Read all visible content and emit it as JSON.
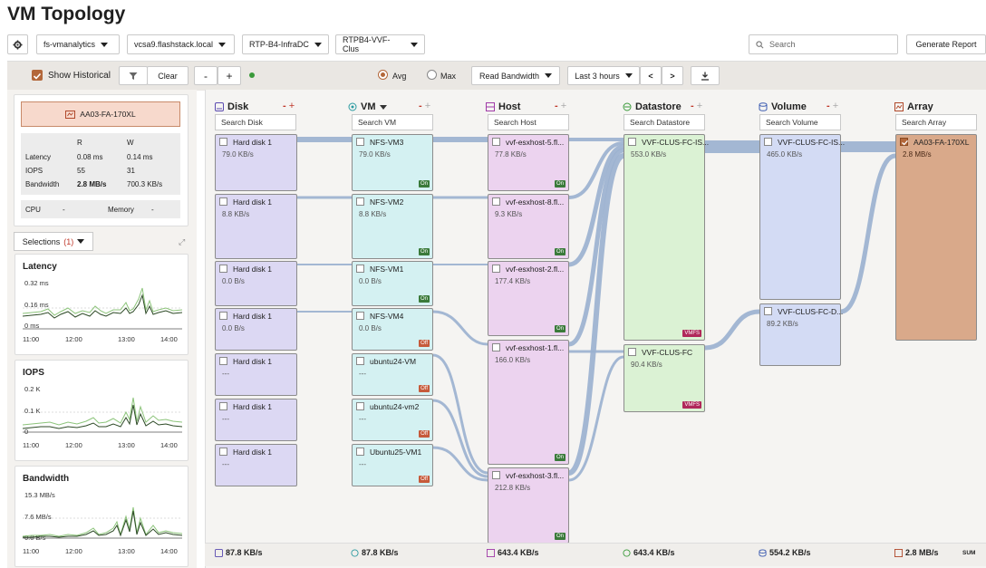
{
  "title": "VM Topology",
  "toolbar": {
    "gear_icon": "gear-icon",
    "vmanalytics": "fs-vmanalytics",
    "vcsa": "vcsa9.flashstack.local",
    "infra": "RTP-B4-InfraDC",
    "cluster": "RTPB4-VVF-Clus",
    "search_placeholder": "Search",
    "generate_report": "Generate Report"
  },
  "controls": {
    "show_historical": "Show Historical",
    "clear": "Clear",
    "minus": "-",
    "plus": "+",
    "avg": "Avg",
    "max": "Max",
    "metric": "Read Bandwidth",
    "range": "Last 3 hours",
    "prev": "<",
    "next": ">"
  },
  "summary": {
    "array_name": "AA03-FA-170XL",
    "col_r": "R",
    "col_w": "W",
    "rows": [
      {
        "label": "Latency",
        "r": "0.08 ms",
        "w": "0.14 ms"
      },
      {
        "label": "IOPS",
        "r": "55",
        "w": "31"
      },
      {
        "label": "Bandwidth",
        "r": "2.8 MB/s",
        "w": "700.3 KB/s"
      }
    ],
    "cpu_label": "CPU",
    "cpu_val": "-",
    "mem_label": "Memory",
    "mem_val": "-"
  },
  "selections": {
    "label": "Selections",
    "count": "(1)"
  },
  "charts": [
    {
      "title": "Latency",
      "ticks": [
        "0.32 ms",
        "0.16 ms",
        "0 ms"
      ],
      "times": [
        "11:00",
        "12:00",
        "13:00",
        "14:00"
      ]
    },
    {
      "title": "IOPS",
      "ticks": [
        "0.2 K",
        "0.1 K",
        "0"
      ],
      "times": [
        "11:00",
        "12:00",
        "13:00",
        "14:00"
      ]
    },
    {
      "title": "Bandwidth",
      "ticks": [
        "15.3 MB/s",
        "7.6 MB/s",
        "0.0 B/s"
      ],
      "times": [
        "11:00",
        "12:00",
        "13:00",
        "14:00"
      ]
    }
  ],
  "columns": [
    {
      "title": "Disk",
      "search": "Search Disk"
    },
    {
      "title": "VM",
      "search": "Search VM"
    },
    {
      "title": "Host",
      "search": "Search Host"
    },
    {
      "title": "Datastore",
      "search": "Search Datastore"
    },
    {
      "title": "Volume",
      "search": "Search Volume"
    },
    {
      "title": "Array",
      "search": "Search Array"
    }
  ],
  "disks": [
    {
      "name": "Hard disk 1",
      "value": "79.0 KB/s"
    },
    {
      "name": "Hard disk 1",
      "value": "8.8 KB/s"
    },
    {
      "name": "Hard disk 1",
      "value": "0.0 B/s"
    },
    {
      "name": "Hard disk 1",
      "value": "0.0 B/s"
    },
    {
      "name": "Hard disk 1",
      "value": "---"
    },
    {
      "name": "Hard disk 1",
      "value": "---"
    },
    {
      "name": "Hard disk 1",
      "value": "---"
    }
  ],
  "vms": [
    {
      "name": "NFS-VM3",
      "value": "79.0 KB/s",
      "state": "On"
    },
    {
      "name": "NFS-VM2",
      "value": "8.8 KB/s",
      "state": "On"
    },
    {
      "name": "NFS-VM1",
      "value": "0.0 B/s",
      "state": "On"
    },
    {
      "name": "NFS-VM4",
      "value": "0.0 B/s",
      "state": "Off"
    },
    {
      "name": "ubuntu24-VM",
      "value": "---",
      "state": "Off"
    },
    {
      "name": "ubuntu24-vm2",
      "value": "---",
      "state": "Off"
    },
    {
      "name": "Ubuntu25-VM1",
      "value": "---",
      "state": "Off"
    }
  ],
  "hosts": [
    {
      "name": "vvf-esxhost-5.fl...",
      "value": "77.8 KB/s",
      "state": "On"
    },
    {
      "name": "vvf-esxhost-8.fl...",
      "value": "9.3 KB/s",
      "state": "On"
    },
    {
      "name": "vvf-esxhost-2.fl...",
      "value": "177.4 KB/s",
      "state": "On"
    },
    {
      "name": "vvf-esxhost-1.fl...",
      "value": "166.0 KB/s",
      "state": "On"
    },
    {
      "name": "vvf-esxhost-3.fl...",
      "value": "212.8 KB/s",
      "state": "On"
    }
  ],
  "datastores": [
    {
      "name": "VVF-CLUS-FC-IS...",
      "value": "553.0 KB/s",
      "tag": "VMFS"
    },
    {
      "name": "VVF-CLUS-FC",
      "value": "90.4 KB/s",
      "tag": "VMFS"
    }
  ],
  "volumes": [
    {
      "name": "VVF-CLUS-FC-IS...",
      "value": "465.0 KB/s"
    },
    {
      "name": "VVF-CLUS-FC-D...",
      "value": "89.2 KB/s"
    }
  ],
  "arrays": [
    {
      "name": "AA03-FA-170XL",
      "value": "2.8 MB/s"
    }
  ],
  "totals": {
    "disk": "87.8 KB/s",
    "vm": "87.8 KB/s",
    "host": "643.4 KB/s",
    "datastore": "643.4 KB/s",
    "volume": "554.2 KB/s",
    "array": "2.8 MB/s",
    "sum": "SUM"
  },
  "colors": {
    "disk": "#dcd8f3",
    "vm": "#d4f1f2",
    "host": "#ecd3ef",
    "datastore": "#dbf2d4",
    "volume": "#d3dbf4",
    "array": "#d9a98a",
    "link": "#9ab0cf"
  }
}
